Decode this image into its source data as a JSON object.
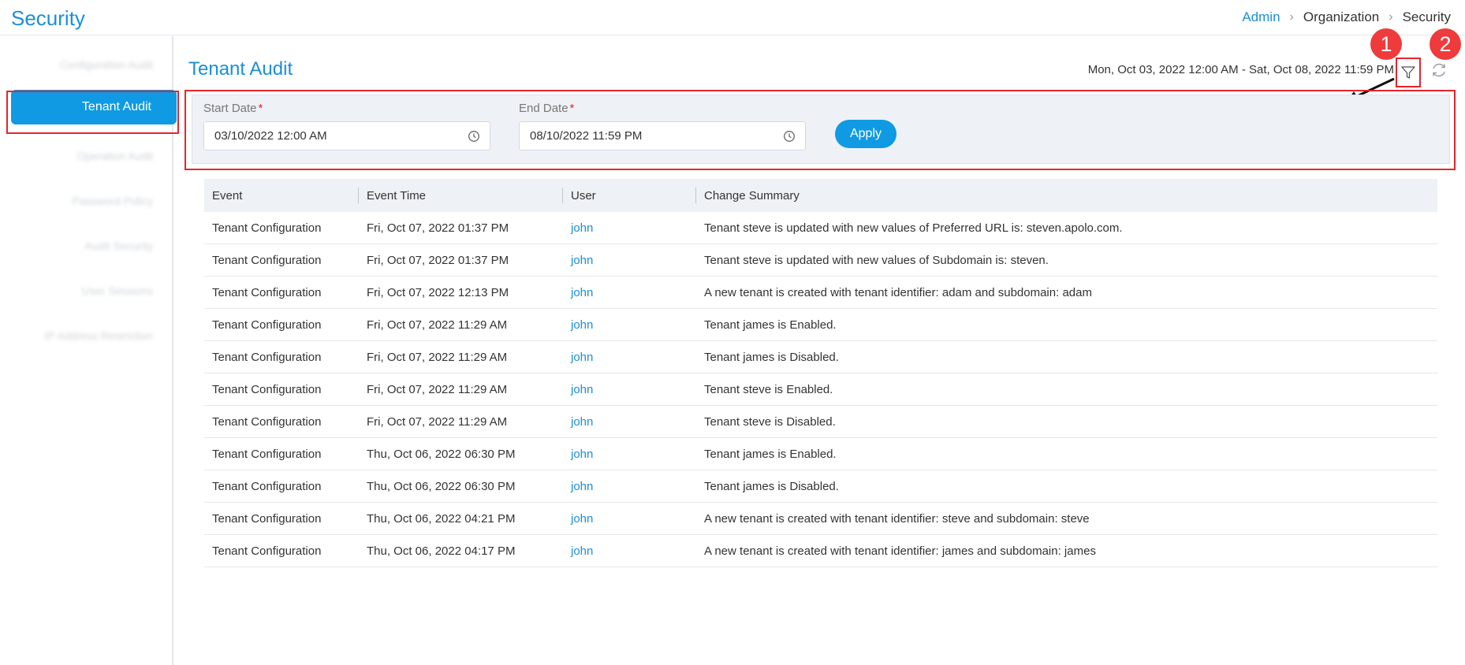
{
  "app": {
    "title": "Security"
  },
  "breadcrumb": {
    "items": [
      "Admin",
      "Organization",
      "Security"
    ]
  },
  "sidebar": {
    "items": [
      "Configuration Audit",
      "Tenant Audit",
      "Operation Audit",
      "Password Policy",
      "Audit Security",
      "User Sessions",
      "IP Address Restriction"
    ],
    "active_index": 1
  },
  "header": {
    "title": "Tenant Audit",
    "date_range": "Mon, Oct 03, 2022 12:00 AM - Sat, Oct 08, 2022 11:59 PM",
    "icons": [
      "filter-icon",
      "refresh-icon"
    ]
  },
  "annotations": {
    "badge1": "1",
    "badge2": "2"
  },
  "filter": {
    "start_label": "Start Date",
    "start_value": "03/10/2022 12:00 AM",
    "end_label": "End Date",
    "end_value": "08/10/2022 11:59 PM",
    "required_mark": "*",
    "apply_label": "Apply"
  },
  "table": {
    "columns": [
      "Event",
      "Event Time",
      "User",
      "Change Summary"
    ],
    "rows": [
      [
        "Tenant Configuration",
        "Fri, Oct 07, 2022 01:37 PM",
        "john",
        "Tenant steve is updated with new values of Preferred URL is: steven.apolo.com."
      ],
      [
        "Tenant Configuration",
        "Fri, Oct 07, 2022 01:37 PM",
        "john",
        "Tenant steve is updated with new values of Subdomain is: steven."
      ],
      [
        "Tenant Configuration",
        "Fri, Oct 07, 2022 12:13 PM",
        "john",
        "A new tenant is created with tenant identifier: adam and subdomain: adam"
      ],
      [
        "Tenant Configuration",
        "Fri, Oct 07, 2022 11:29 AM",
        "john",
        "Tenant james is Enabled."
      ],
      [
        "Tenant Configuration",
        "Fri, Oct 07, 2022 11:29 AM",
        "john",
        "Tenant james is Disabled."
      ],
      [
        "Tenant Configuration",
        "Fri, Oct 07, 2022 11:29 AM",
        "john",
        "Tenant steve is Enabled."
      ],
      [
        "Tenant Configuration",
        "Fri, Oct 07, 2022 11:29 AM",
        "john",
        "Tenant steve is Disabled."
      ],
      [
        "Tenant Configuration",
        "Thu, Oct 06, 2022 06:30 PM",
        "john",
        "Tenant james is Enabled."
      ],
      [
        "Tenant Configuration",
        "Thu, Oct 06, 2022 06:30 PM",
        "john",
        "Tenant james is Disabled."
      ],
      [
        "Tenant Configuration",
        "Thu, Oct 06, 2022 04:21 PM",
        "john",
        "A new tenant is created with tenant identifier: steve and subdomain: steve"
      ],
      [
        "Tenant Configuration",
        "Thu, Oct 06, 2022 04:17 PM",
        "john",
        "A new tenant is created with tenant identifier: james and subdomain: james"
      ]
    ]
  },
  "colors": {
    "accent": "#0f9ae3",
    "link": "#1a8fd8",
    "highlight": "#e3262b",
    "badge": "#ef3b3b"
  }
}
